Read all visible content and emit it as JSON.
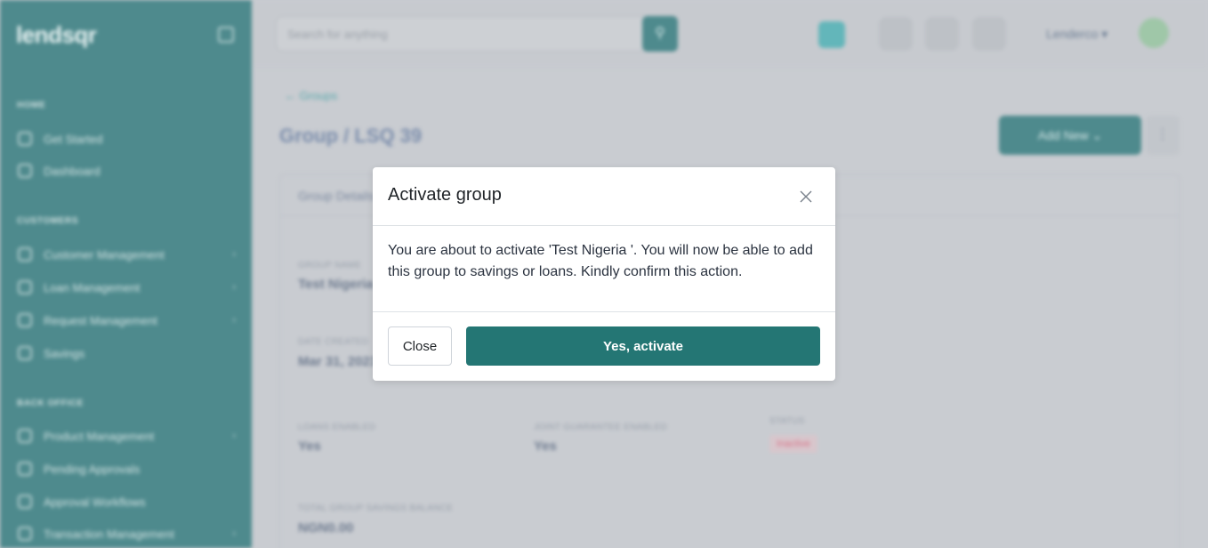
{
  "brand": {
    "logo_text": "lendsqr"
  },
  "sidebar": {
    "sections": [
      {
        "title": "HOME"
      },
      {
        "title": "CUSTOMERS"
      },
      {
        "title": "BACK OFFICE"
      }
    ],
    "items": [
      {
        "label": "Get Started"
      },
      {
        "label": "Dashboard"
      },
      {
        "label": "Customer Management"
      },
      {
        "label": "Loan Management"
      },
      {
        "label": "Request Management"
      },
      {
        "label": "Savings"
      },
      {
        "label": "Product Management"
      },
      {
        "label": "Pending Approvals"
      },
      {
        "label": "Approval Workflows"
      },
      {
        "label": "Transaction Management"
      }
    ]
  },
  "topbar": {
    "search_placeholder": "Search for anything",
    "user_name": "Lenderco"
  },
  "page": {
    "back_link": "Groups",
    "title": "Group / LSQ 39",
    "add_new_label": "Add New",
    "panel_title": "Group Details",
    "fields": [
      {
        "label": "GROUP NAME",
        "value": "Test Nigeria"
      },
      {
        "label": "DATE CREATED",
        "value": "Mar 31, 2023"
      },
      {
        "label": "LOANS ENABLED",
        "value": "Yes"
      },
      {
        "label": "JOINT GUARANTEE ENABLED",
        "value": "Yes"
      },
      {
        "label": "STATUS",
        "value": "Inactive"
      },
      {
        "label": "TOTAL GROUP SAVINGS BALANCE",
        "value": "NGN0.00"
      }
    ]
  },
  "modal": {
    "title": "Activate group",
    "message": "You are about to activate 'Test Nigeria '. You will now be able to add this group to savings or loans. Kindly confirm this action.",
    "close_label": "Close",
    "confirm_label": "Yes, activate"
  },
  "colors": {
    "primary": "#247674",
    "sidebar": "#4e8a8d",
    "overlay": "#c9ccd1"
  }
}
